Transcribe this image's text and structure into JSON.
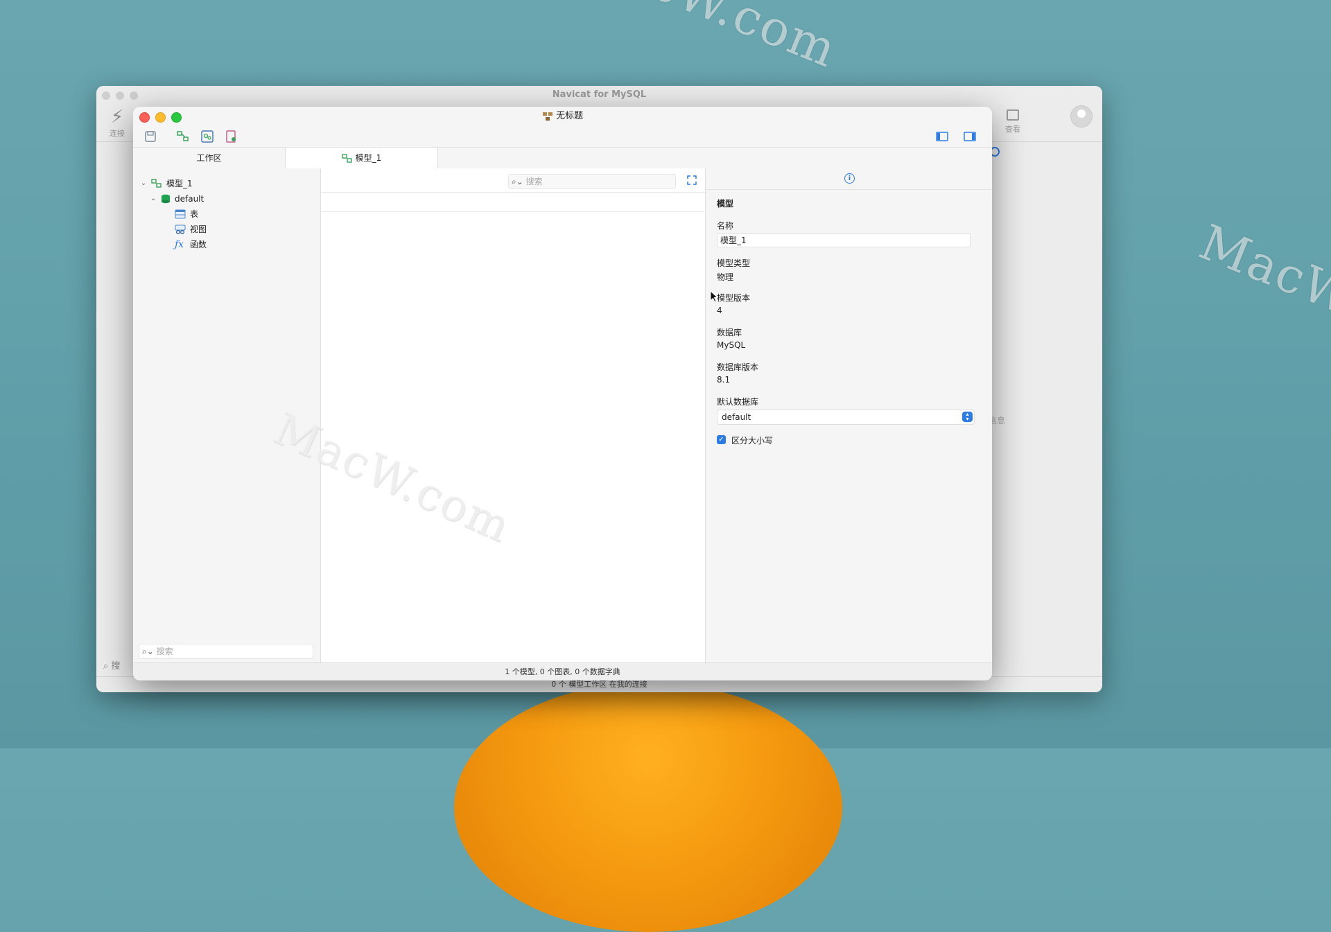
{
  "watermark": "MacW.com",
  "back_window": {
    "title": "Navicat for MySQL",
    "connect_label": "连接",
    "view_label": "查看",
    "side_text": "信息",
    "search_placeholder": "搜",
    "status_text": "0 个 模型工作区 在我的连接"
  },
  "window": {
    "title": "无标题",
    "tabs": [
      {
        "label": "工作区"
      },
      {
        "label": "模型_1"
      }
    ],
    "tree": {
      "model": "模型_1",
      "schema": "default",
      "items": [
        {
          "label": "表",
          "icon": "table-icon"
        },
        {
          "label": "视图",
          "icon": "view-icon"
        },
        {
          "label": "函数",
          "icon": "function-icon"
        }
      ]
    },
    "left_search_placeholder": "搜索",
    "middle_search_placeholder": "搜索",
    "inspector": {
      "section": "模型",
      "name_label": "名称",
      "name_value": "模型_1",
      "type_label": "模型类型",
      "type_value": "物理",
      "version_label": "模型版本",
      "version_value": "4",
      "db_label": "数据库",
      "db_value": "MySQL",
      "db_version_label": "数据库版本",
      "db_version_value": "8.1",
      "default_db_label": "默认数据库",
      "default_db_value": "default",
      "case_label": "区分大小写",
      "case_checked": true
    },
    "status_text": "1 个模型, 0 个图表, 0 个数据字典"
  },
  "colors": {
    "accent": "#2d7be5",
    "background": "#64a2ad",
    "model_icon": "#3aa35c",
    "schema_icon": "#1fa552"
  }
}
